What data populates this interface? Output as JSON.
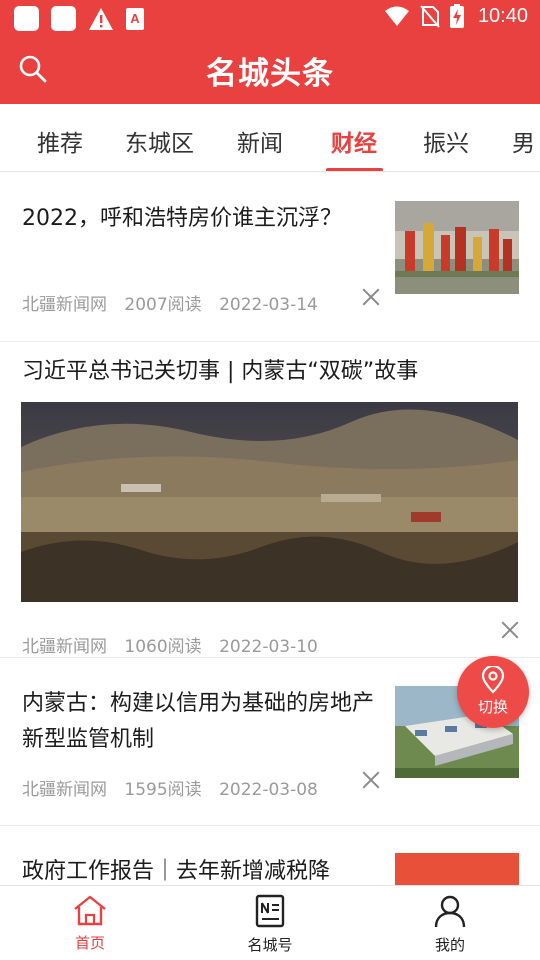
{
  "status_bar": {
    "time": "10:40"
  },
  "header": {
    "title": "名城头条"
  },
  "tabs": [
    {
      "label": "推荐"
    },
    {
      "label": "东城区"
    },
    {
      "label": "新闻"
    },
    {
      "label": "财经"
    },
    {
      "label": "振兴"
    },
    {
      "label": "男"
    }
  ],
  "active_tab": "财经",
  "articles": [
    {
      "title": "2022，呼和浩特房价谁主沉浮？",
      "source": "北疆新闻网",
      "reads": "2007阅读",
      "date": "2022-03-14"
    },
    {
      "title": "习近平总书记关切事 | 内蒙古“双碳”故事",
      "source": "北疆新闻网",
      "reads": "1060阅读",
      "date": "2022-03-10"
    },
    {
      "title": "内蒙古：构建以信用为基础的房地产新型监管机制",
      "source": "北疆新闻网",
      "reads": "1595阅读",
      "date": "2022-03-08"
    },
    {
      "title": "政府工作报告｜去年新增减税降"
    }
  ],
  "fab": {
    "label": "切换"
  },
  "bottom_nav": [
    {
      "label": "首页"
    },
    {
      "label": "名城号"
    },
    {
      "label": "我的"
    }
  ],
  "colors": {
    "brand_red": "#e8413f",
    "meta_gray": "#9a9a9a"
  }
}
